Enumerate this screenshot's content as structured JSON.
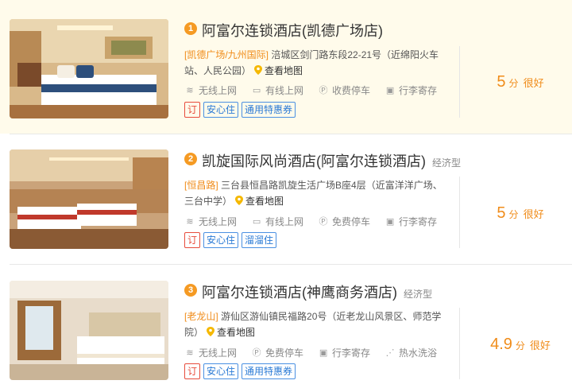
{
  "hotels": [
    {
      "rank": "1",
      "name": "阿富尔连锁酒店(凯德广场店)",
      "type": "",
      "area": "[凯德广场/九州国际]",
      "address": "涪城区剑门路东段22-21号（近绵阳火车站、人民公园）",
      "map_label": "查看地图",
      "facilities": [
        {
          "label": "无线上网",
          "icon": "wifi-icon"
        },
        {
          "label": "有线上网",
          "icon": "monitor-icon"
        },
        {
          "label": "收费停车",
          "icon": "parking-icon"
        },
        {
          "label": "行李寄存",
          "icon": "luggage-icon"
        }
      ],
      "tags": [
        {
          "label": "订",
          "kind": "book"
        },
        {
          "label": "安心住",
          "kind": "blue"
        },
        {
          "label": "通用特惠券",
          "kind": "blue"
        }
      ],
      "score": "5",
      "unit": "分",
      "level": "很好"
    },
    {
      "rank": "2",
      "name": "凯旋国际风尚酒店(阿富尔连锁酒店)",
      "type": "经济型",
      "area": "[恒昌路]",
      "address": "三台县恒昌路凯旋生活广场B座4层（近富洋洋广场、三台中学）",
      "map_label": "查看地图",
      "facilities": [
        {
          "label": "无线上网",
          "icon": "wifi-icon"
        },
        {
          "label": "有线上网",
          "icon": "monitor-icon"
        },
        {
          "label": "免费停车",
          "icon": "parking-icon"
        },
        {
          "label": "行李寄存",
          "icon": "luggage-icon"
        }
      ],
      "tags": [
        {
          "label": "订",
          "kind": "book"
        },
        {
          "label": "安心住",
          "kind": "blue"
        },
        {
          "label": "溜溜住",
          "kind": "blue"
        }
      ],
      "score": "5",
      "unit": "分",
      "level": "很好"
    },
    {
      "rank": "3",
      "name": "阿富尔连锁酒店(神鹰商务酒店)",
      "type": "经济型",
      "area": "[老龙山]",
      "address": "游仙区游仙镇民福路20号（近老龙山风景区、师范学院）",
      "map_label": "查看地图",
      "facilities": [
        {
          "label": "无线上网",
          "icon": "wifi-icon"
        },
        {
          "label": "免费停车",
          "icon": "parking-icon"
        },
        {
          "label": "行李寄存",
          "icon": "luggage-icon"
        },
        {
          "label": "热水洗浴",
          "icon": "shower-icon"
        }
      ],
      "tags": [
        {
          "label": "订",
          "kind": "book"
        },
        {
          "label": "安心住",
          "kind": "blue"
        },
        {
          "label": "通用特惠券",
          "kind": "blue"
        }
      ],
      "score": "4.9",
      "unit": "分",
      "level": "很好"
    }
  ],
  "colors": {
    "accent": "#f08c1a",
    "highlight_bg": "#fffbeb",
    "tag_blue": "#2a7ad5",
    "tag_red": "#e74c3c"
  }
}
